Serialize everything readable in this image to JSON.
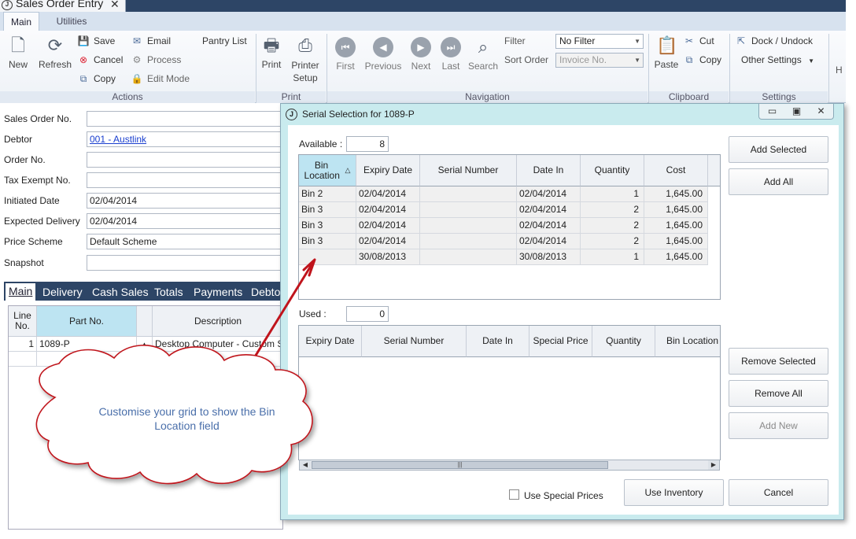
{
  "app": {
    "doc_tab_title": "Sales Order Entry",
    "ribbon_tabs": [
      "Main",
      "Utilities"
    ]
  },
  "ribbon": {
    "actions": {
      "new": "New",
      "refresh": "Refresh",
      "save": "Save",
      "cancel": "Cancel",
      "copy": "Copy",
      "email": "Email",
      "process": "Process",
      "edit_mode": "Edit Mode",
      "pantry_list": "Pantry List",
      "group": "Actions"
    },
    "print": {
      "print": "Print",
      "printer_setup_1": "Printer",
      "printer_setup_2": "Setup",
      "group": "Print"
    },
    "navigation": {
      "first": "First",
      "previous": "Previous",
      "next": "Next",
      "last": "Last",
      "search": "Search",
      "filter_label": "Filter",
      "filter_value": "No Filter",
      "sort_label": "Sort Order",
      "sort_value": "Invoice No.",
      "group": "Navigation"
    },
    "clipboard": {
      "paste": "Paste",
      "cut": "Cut",
      "copy": "Copy",
      "group": "Clipboard"
    },
    "settings": {
      "dock": "Dock / Undock",
      "other": "Other Settings",
      "group": "Settings"
    },
    "overflow_h": "H"
  },
  "form": {
    "fields": [
      {
        "label": "Sales Order No.",
        "value": ""
      },
      {
        "label": "Debtor",
        "value": "001 - Austlink"
      },
      {
        "label": "Order No.",
        "value": ""
      },
      {
        "label": "Tax Exempt No.",
        "value": ""
      },
      {
        "label": "Initiated Date",
        "value": "02/04/2014"
      },
      {
        "label": "Expected Delivery",
        "value": "02/04/2014"
      },
      {
        "label": "Price Scheme",
        "value": "Default Scheme"
      },
      {
        "label": "Snapshot",
        "value": ""
      }
    ],
    "sub_tabs": [
      "Main",
      "Delivery",
      "Cash Sales",
      "Totals",
      "Payments",
      "Debto"
    ],
    "lines_grid": {
      "headers": [
        "Line No.",
        "Part No.",
        "Description"
      ],
      "rows": [
        {
          "line": "1",
          "part": "1089-P",
          "description": "Desktop Computer  - Custom Spe"
        }
      ]
    }
  },
  "callout": {
    "text": "Customise your grid to show the Bin Location field"
  },
  "dialog": {
    "title": "Serial Selection for 1089-P",
    "available_label": "Available :",
    "available_value": "8",
    "used_label": "Used :",
    "used_value": "0",
    "available_grid": {
      "headers": [
        "Bin Location",
        "Expiry Date",
        "Serial Number",
        "Date In",
        "Quantity",
        "Cost"
      ],
      "rows": [
        [
          "Bin 2",
          "02/04/2014",
          "",
          "02/04/2014",
          "1",
          "1,645.00"
        ],
        [
          "Bin 3",
          "02/04/2014",
          "",
          "02/04/2014",
          "2",
          "1,645.00"
        ],
        [
          "Bin 3",
          "02/04/2014",
          "",
          "02/04/2014",
          "2",
          "1,645.00"
        ],
        [
          "Bin 3",
          "02/04/2014",
          "",
          "02/04/2014",
          "2",
          "1,645.00"
        ],
        [
          "",
          "30/08/2013",
          "",
          "30/08/2013",
          "1",
          "1,645.00"
        ]
      ]
    },
    "used_grid": {
      "headers": [
        "Expiry Date",
        "Serial Number",
        "Date In",
        "Special Price",
        "Quantity",
        "Bin Location"
      ]
    },
    "buttons": {
      "add_selected": "Add Selected",
      "add_all": "Add All",
      "remove_selected": "Remove Selected",
      "remove_all": "Remove All",
      "add_new": "Add New",
      "use_inventory": "Use Inventory",
      "cancel": "Cancel"
    },
    "use_special_prices": "Use Special Prices"
  },
  "colors": {
    "title_bar": "#2d4566",
    "dialog_frame": "#c9ebee",
    "selected_header": "#bde4f2",
    "callout_stroke": "#c0141c",
    "callout_text": "#4a6faa",
    "link": "#1a3fcf"
  }
}
